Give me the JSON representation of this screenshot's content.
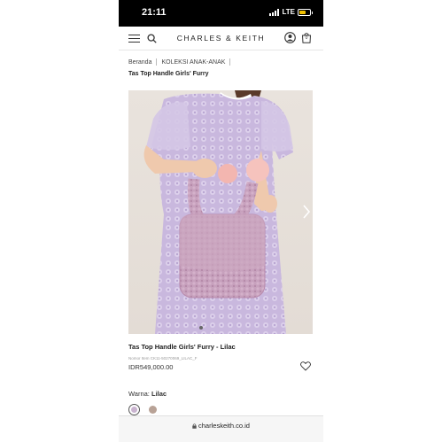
{
  "status_bar": {
    "time": "21:11",
    "network": "LTE",
    "battery_level": 0.6
  },
  "header": {
    "brand": "CHARLES & KEITH",
    "cart_count": "0",
    "icons": [
      "menu-icon",
      "search-icon",
      "user-icon",
      "bag-icon"
    ]
  },
  "breadcrumb": {
    "items": [
      "Beranda",
      "KOLEKSI ANAK-ANAK"
    ],
    "current": "Tas Top Handle Girls' Furry"
  },
  "product": {
    "image_alt": "Tas Top Handle Girls' Furry - Lilac",
    "name": "Tas Top Handle Girls' Furry - Lilac",
    "code": "Nomor Item CK11-50270069_LILAC_F",
    "price": "IDR549,000.00",
    "color_label": "Warna:",
    "color_value": "Lilac",
    "swatches": [
      {
        "name": "Lilac",
        "color": "#c9b3cf",
        "selected": true
      },
      {
        "name": "Brown",
        "color": "#b8a296",
        "selected": false
      }
    ]
  },
  "browser": {
    "url": "charleskeith.co.id"
  },
  "colors": {
    "dress": "#c7b6dc",
    "bag": "#c8a0bc",
    "background": "#e6e0da"
  }
}
